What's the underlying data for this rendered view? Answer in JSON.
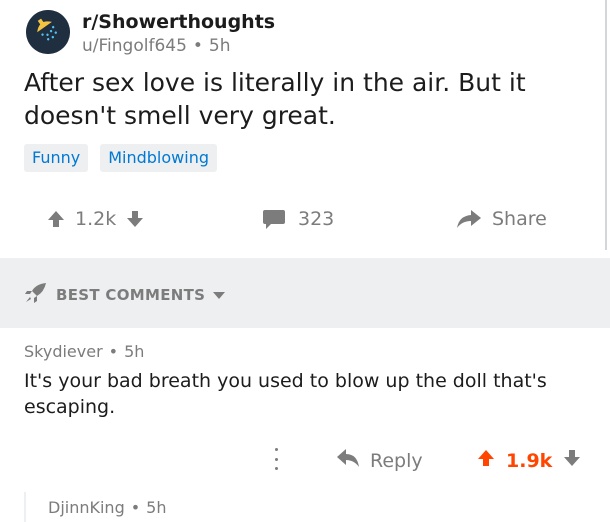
{
  "post": {
    "subreddit": "r/Showerthoughts",
    "author": "u/Fingolf645",
    "age": "5h",
    "separator": "•",
    "title": "After sex love is literally in the air. But it doesn't smell very great.",
    "flairs": [
      "Funny",
      "Mindblowing"
    ],
    "votes": "1.2k",
    "comments": "323",
    "share_label": "Share"
  },
  "comments_section": {
    "sort_label": "BEST COMMENTS"
  },
  "comment": {
    "author": "Skydiever",
    "age": "5h",
    "body": "It's your bad breath you used to blow up the doll that's escaping.",
    "reply_label": "Reply",
    "score": "1.9k"
  },
  "child_comment": {
    "author": "DjinnKing",
    "age": "5h"
  },
  "colors": {
    "accent_orange": "#ff4500",
    "flair_blue": "#0079d3",
    "muted_gray": "#7c7c7c",
    "section_bg": "#edeff1"
  },
  "icons": {
    "subreddit": "shower-head-icon",
    "upvote": "arrow-up-icon",
    "downvote": "arrow-down-icon",
    "comments": "comment-bubble-icon",
    "share": "share-arrow-icon",
    "sort": "rocket-icon",
    "more": "more-vertical-icon",
    "reply": "reply-arrow-icon"
  }
}
